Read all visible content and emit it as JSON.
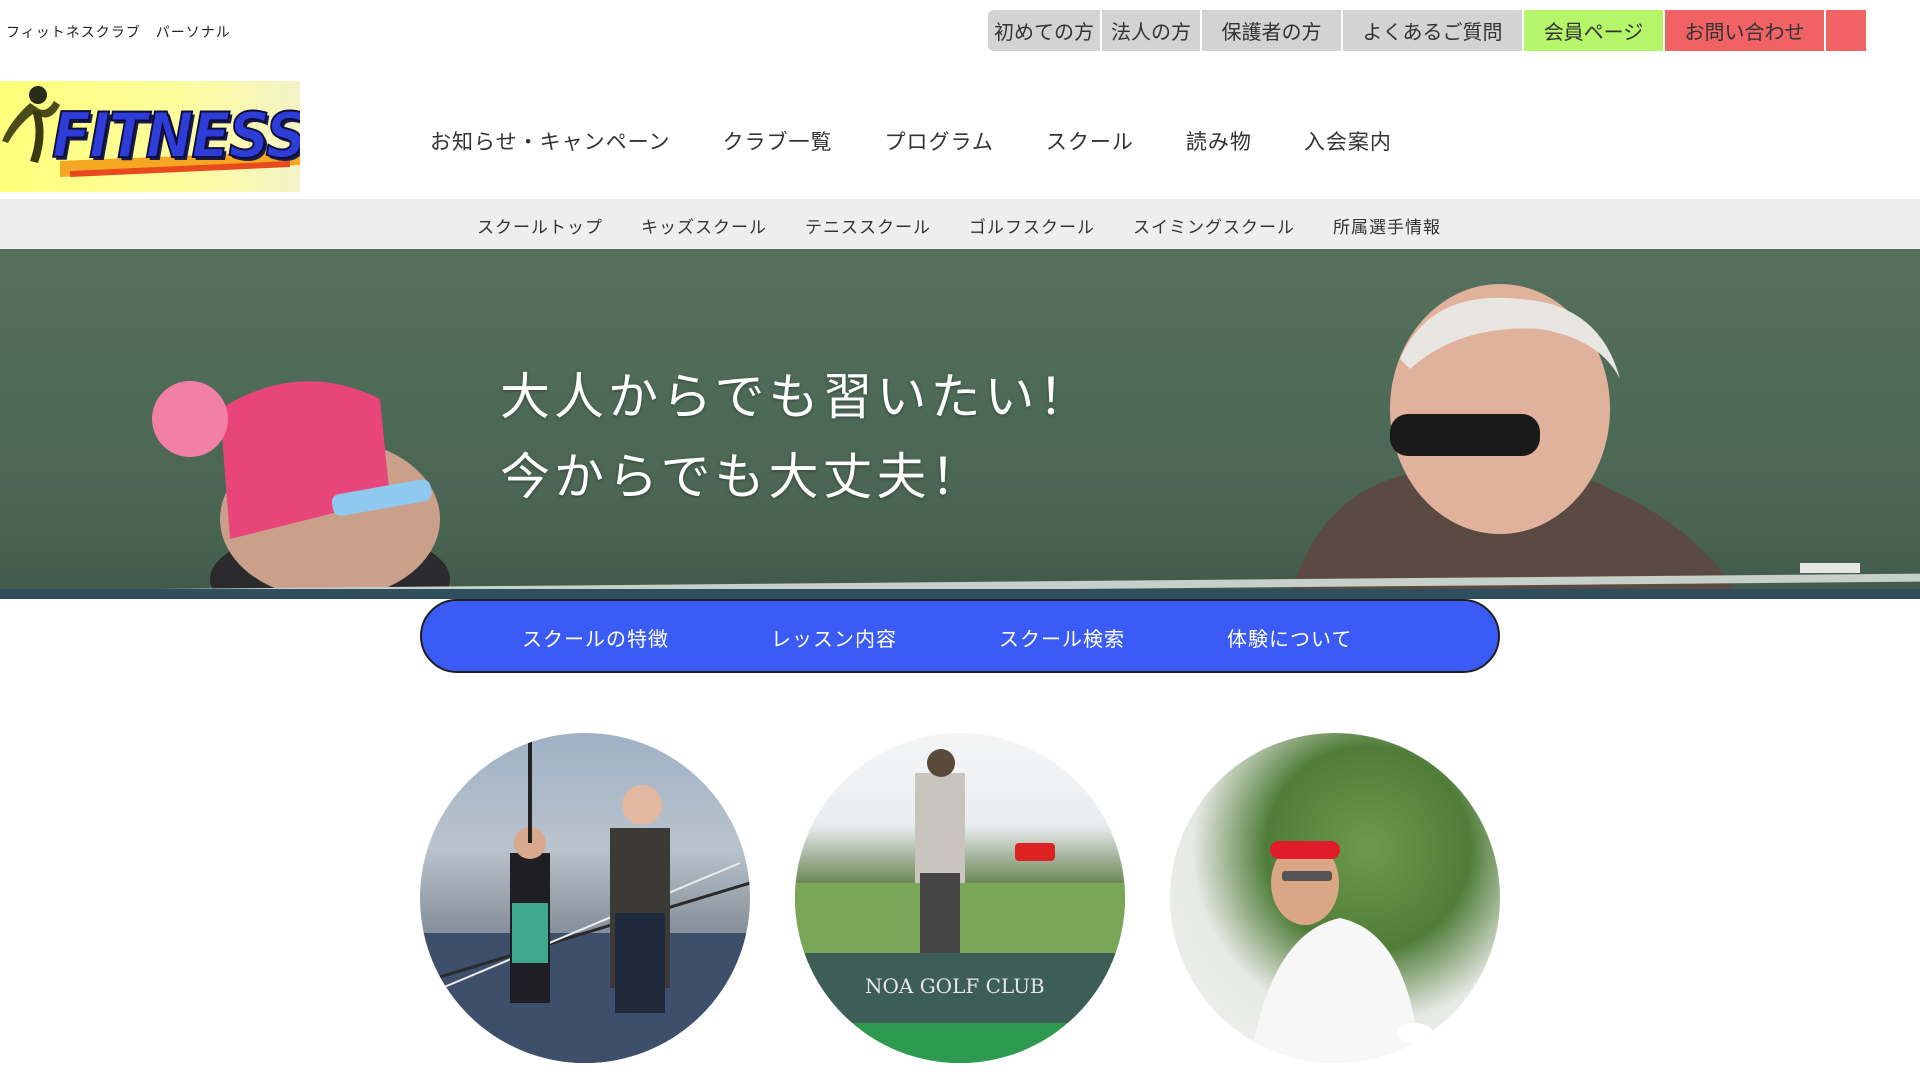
{
  "header": {
    "site_tag": "フィットネスクラブ　パーソナル",
    "utility_nav": [
      {
        "label": "初めての方"
      },
      {
        "label": "法人の方"
      },
      {
        "label": "保護者の方"
      },
      {
        "label": "よくあるご質問"
      },
      {
        "label": "会員ページ"
      },
      {
        "label": "お問い合わせ"
      }
    ],
    "logo_text": "FITNESS"
  },
  "main_nav": [
    {
      "label": "お知らせ・キャンペーン"
    },
    {
      "label": "クラブ一覧"
    },
    {
      "label": "プログラム"
    },
    {
      "label": "スクール"
    },
    {
      "label": "読み物"
    },
    {
      "label": "入会案内"
    }
  ],
  "sub_nav": [
    {
      "label": "スクールトップ"
    },
    {
      "label": "キッズスクール"
    },
    {
      "label": "テニススクール"
    },
    {
      "label": "ゴルフスクール"
    },
    {
      "label": "スイミングスクール"
    },
    {
      "label": "所属選手情報"
    }
  ],
  "hero": {
    "line1": "大人からでも習いたい！",
    "line2": "今からでも大丈夫！"
  },
  "school_nav": [
    {
      "label": "スクールの特徴"
    },
    {
      "label": "レッスン内容"
    },
    {
      "label": "スクール検索"
    },
    {
      "label": "体験について"
    }
  ],
  "photos": {
    "golf_sign": "NOA GOLF CLUB"
  },
  "colors": {
    "utility_gray": "#d3d3d3",
    "member_green": "#b4f56a",
    "contact_red": "#f06264",
    "pill_blue": "#3b5bf6",
    "subnav_bg": "#eeeeee"
  }
}
